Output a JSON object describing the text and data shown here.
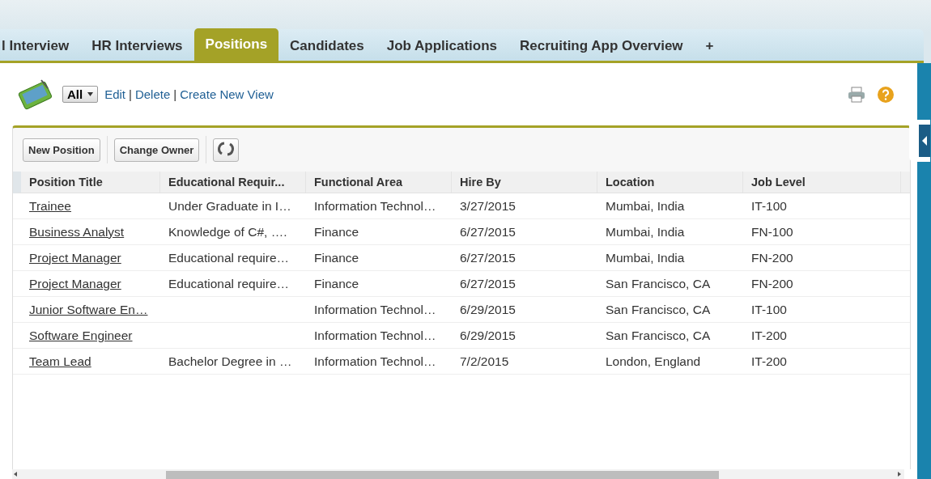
{
  "tabs": [
    {
      "label": "l Interview",
      "selected": false
    },
    {
      "label": "HR Interviews",
      "selected": false
    },
    {
      "label": "Positions",
      "selected": true
    },
    {
      "label": "Candidates",
      "selected": false
    },
    {
      "label": "Job Applications",
      "selected": false
    },
    {
      "label": "Recruiting App Overview",
      "selected": false
    },
    {
      "label": "+",
      "selected": false
    }
  ],
  "view": {
    "selected_view": "All",
    "links": [
      "Edit",
      "Delete",
      "Create New View"
    ],
    "link_separator": "|"
  },
  "toolbar": {
    "buttons": [
      "New Position",
      "Change Owner"
    ]
  },
  "table": {
    "columns": [
      "Position Title",
      "Educational Requir...",
      "Functional Area",
      "Hire By",
      "Location",
      "Job Level"
    ],
    "rows": [
      {
        "title": "Trainee",
        "education": "Under Graduate in I…",
        "area": "Information Technol…",
        "hire_by": "3/27/2015",
        "location": "Mumbai, India",
        "level": "IT-100"
      },
      {
        "title": "Business Analyst",
        "education": "Knowledge of C#, ….",
        "area": "Finance",
        "hire_by": "6/27/2015",
        "location": "Mumbai, India",
        "level": "FN-100"
      },
      {
        "title": "Project Manager",
        "education": "Educational require…",
        "area": "Finance",
        "hire_by": "6/27/2015",
        "location": "Mumbai, India",
        "level": "FN-200"
      },
      {
        "title": "Project Manager",
        "education": "Educational require…",
        "area": "Finance",
        "hire_by": "6/27/2015",
        "location": "San Francisco, CA",
        "level": "FN-200"
      },
      {
        "title": "Junior Software En…",
        "area": "Information Technol…",
        "hire_by": "6/29/2015",
        "location": "San Francisco, CA",
        "level": "IT-100"
      },
      {
        "title": "Software Engineer",
        "area": "Information Technol…",
        "hire_by": "6/29/2015",
        "location": "San Francisco, CA",
        "level": "IT-200"
      },
      {
        "title": "Team Lead",
        "education": "Bachelor Degree in …",
        "area": "Information Technol…",
        "hire_by": "7/2/2015",
        "location": "London, England",
        "level": "IT-200"
      }
    ]
  }
}
